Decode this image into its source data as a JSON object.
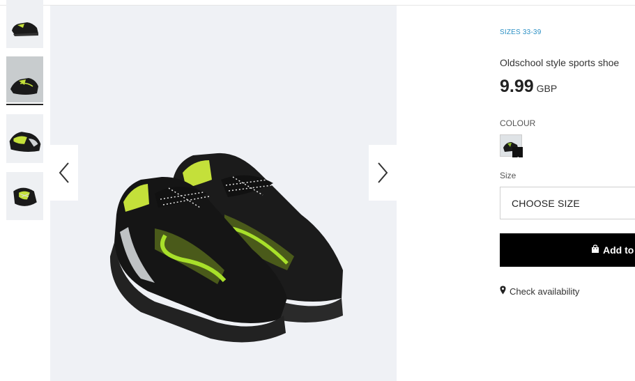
{
  "gallery": {
    "thumbnails": [
      {
        "icon": "shoe-thumbnail-side-view"
      },
      {
        "icon": "shoe-thumbnail-pair-view",
        "selected": true
      },
      {
        "icon": "shoe-thumbnail-back-view"
      },
      {
        "icon": "shoe-thumbnail-top-view"
      }
    ],
    "main_image_icon": "shoe-pair-image",
    "prev_icon": "chevron-left-icon",
    "next_icon": "chevron-right-icon"
  },
  "product": {
    "sizes_tag": "SIZES 33-39",
    "name": "Oldschool style sports shoe",
    "price": "9.99",
    "currency": "GBP",
    "colour_label": "COLOUR",
    "size_label": "Size",
    "size_select_value": "CHOOSE SIZE",
    "add_button_label": "Add to",
    "check_availability": "Check availability"
  },
  "colors": {
    "accent_blue": "#2a8fc4",
    "button_black": "#000000",
    "shoe_black": "#1a1a1a",
    "shoe_lime": "#c4e03a"
  }
}
